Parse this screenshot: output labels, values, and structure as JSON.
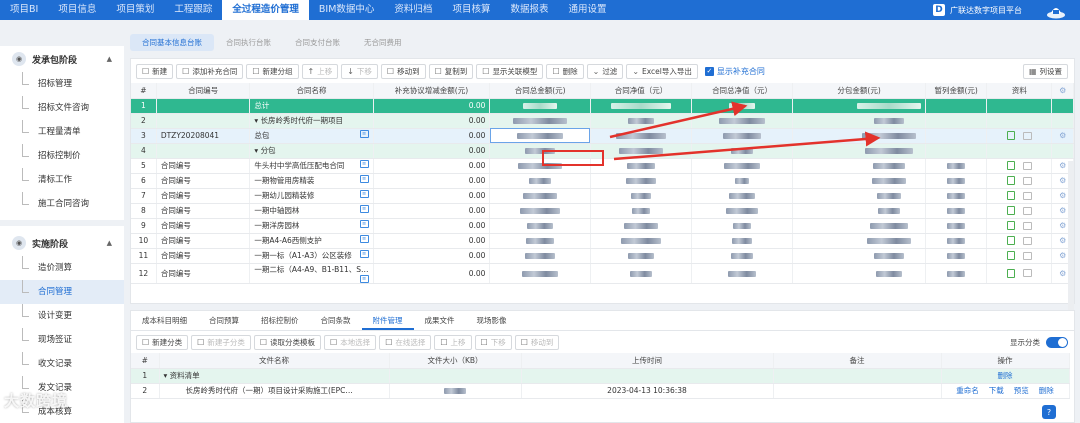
{
  "topnav": [
    "项目BI",
    "项目信息",
    "项目策划",
    "工程跟踪",
    "全过程造价管理",
    "BIM数据中心",
    "资料归档",
    "项目核算",
    "数据报表",
    "通用设置"
  ],
  "brand": {
    "logo": "D",
    "name": "广联达数字项目平台"
  },
  "sidebar": {
    "sections": [
      {
        "title": "发承包阶段",
        "icon": "stage-icon",
        "items": [
          "招标管理",
          "招标文件咨询",
          "工程量清单",
          "招标控制价",
          "清标工作",
          "施工合同咨询"
        ]
      },
      {
        "title": "实施阶段",
        "icon": "stage-icon",
        "items": [
          "造价测算",
          "合同管理",
          "设计变更",
          "现场签证",
          "收文记录",
          "发文记录",
          "成本核算"
        ]
      }
    ],
    "active_item": "合同管理"
  },
  "subtabs": [
    "合同基本信息台账",
    "合同执行台账",
    "合同支付台账",
    "无合同费用"
  ],
  "toolbar": [
    {
      "label": "新建",
      "icon": "☐"
    },
    {
      "label": "添加补充合同",
      "icon": "☐"
    },
    {
      "label": "新建分组",
      "icon": "☐"
    },
    {
      "label": "上移",
      "icon": "↑",
      "disabled": true
    },
    {
      "label": "下移",
      "icon": "↓",
      "disabled": true
    },
    {
      "label": "移动到",
      "icon": "☐"
    },
    {
      "label": "复制到",
      "icon": "☐"
    },
    {
      "label": "显示关联模型",
      "icon": "☐"
    },
    {
      "label": "删除",
      "icon": "☐"
    },
    {
      "label": "过滤",
      "icon": "⌄"
    },
    {
      "label": "Excel导入导出",
      "icon": "⌄"
    }
  ],
  "show_supplement": "显示补充合同",
  "column_settings": "列设置",
  "table": {
    "headers": [
      "#",
      "合同编号",
      "合同名称",
      "补充协议增减金额(元)",
      "合同总金额(元)",
      "合同净值（元）",
      "合同总净值（元）",
      "分包金额(元)",
      "暂列金额(元)",
      "资料"
    ],
    "rows": [
      {
        "idx": "1",
        "code": "",
        "name": "总计",
        "supp": "0.00",
        "total": "",
        "type": "total"
      },
      {
        "idx": "2",
        "code": "",
        "name": "长房岭秀时代府一期项目",
        "supp": "0.00",
        "total": "",
        "type": "sub"
      },
      {
        "idx": "3",
        "code": "DTZY20208041",
        "name": "总包",
        "supp": "0.00",
        "total": "",
        "type": "sel"
      },
      {
        "idx": "4",
        "code": "",
        "name": "分包",
        "supp": "0.00",
        "total": "",
        "type": "sub"
      },
      {
        "idx": "5",
        "code": "合同编号",
        "name": "牛头村中学高低压配电合同",
        "supp": "0.00",
        "total": "",
        "type": "normal"
      },
      {
        "idx": "6",
        "code": "合同编号",
        "name": "一期物管用房精装",
        "supp": "0.00",
        "total": "",
        "type": "normal"
      },
      {
        "idx": "7",
        "code": "合同编号",
        "name": "一期幼儿园精装修",
        "supp": "0.00",
        "total": "",
        "type": "normal"
      },
      {
        "idx": "8",
        "code": "合同编号",
        "name": "一期中轴园林",
        "supp": "0.00",
        "total": "",
        "type": "normal"
      },
      {
        "idx": "9",
        "code": "合同编号",
        "name": "一期洋房园林",
        "supp": "0.00",
        "total": "",
        "type": "normal"
      },
      {
        "idx": "10",
        "code": "合同编号",
        "name": "一期A4-A6西侧支护",
        "supp": "0.00",
        "total": "",
        "type": "normal"
      },
      {
        "idx": "11",
        "code": "合同编号",
        "name": "一期一标（A1-A3）公区装修",
        "supp": "0.00",
        "total": "",
        "type": "normal"
      },
      {
        "idx": "12",
        "code": "合同编号",
        "name": "一期二标（A4-A9、B1-B11、S…",
        "supp": "0.00",
        "total": "",
        "type": "normal"
      }
    ]
  },
  "bottom": {
    "tabs": [
      "成本科目明细",
      "合同预算",
      "招标控制价",
      "合同条款",
      "附件管理",
      "成果文件",
      "现场影像"
    ],
    "active_tab": "附件管理",
    "toolbar": [
      {
        "label": "新建分类",
        "disabled": false
      },
      {
        "label": "新建子分类",
        "disabled": true
      },
      {
        "label": "读取分类模板",
        "disabled": false
      },
      {
        "label": "本地选择",
        "disabled": true
      },
      {
        "label": "在线选择",
        "disabled": true
      },
      {
        "label": "上移",
        "disabled": true
      },
      {
        "label": "下移",
        "disabled": true
      },
      {
        "label": "移动到",
        "disabled": true
      }
    ],
    "show_category": "显示分类",
    "headers": [
      "#",
      "文件名称",
      "文件大小（KB）",
      "上传时间",
      "备注",
      "操作"
    ],
    "rows": [
      {
        "idx": "1",
        "name": "资料清单",
        "size": "",
        "time": "",
        "note": "",
        "ops": [
          "删除"
        ],
        "type": "group"
      },
      {
        "idx": "2",
        "name": "长房岭秀时代府（一期）项目设计采购施工(EPC…",
        "size": "",
        "time": "2023-04-13 10:36:38",
        "note": "",
        "ops": [
          "重命名",
          "下载",
          "预览",
          "删除"
        ],
        "type": "file"
      }
    ]
  },
  "watermark": "大数跨境",
  "help": "?",
  "colors": {
    "primary": "#1f6ed3",
    "total_row": "#2fb890",
    "highlight": "#e3322b"
  }
}
